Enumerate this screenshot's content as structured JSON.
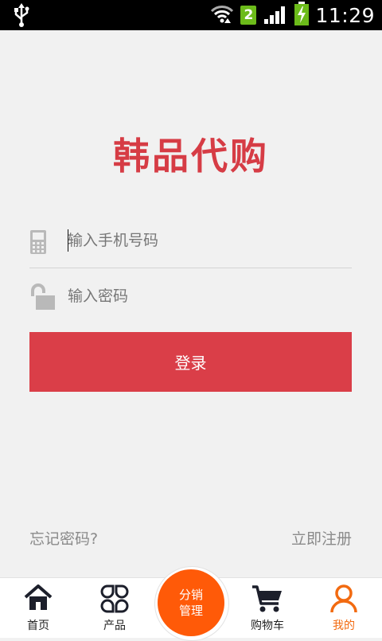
{
  "status_bar": {
    "usb_icon": "usb-icon",
    "wifi_icon": "wifi-icon",
    "sim_slot": "2",
    "signal_icon": "signal-icon",
    "battery_icon": "battery-charging-icon",
    "time": "11:29"
  },
  "brand": {
    "title": "韩品代购",
    "color": "#d63c45"
  },
  "login_form": {
    "phone": {
      "icon": "phone-icon",
      "placeholder": "输入手机号码",
      "value": ""
    },
    "password": {
      "icon": "unlock-icon",
      "placeholder": "输入密码",
      "value": ""
    },
    "login_button": "登录",
    "accent_color": "#da3e48"
  },
  "links": {
    "forgot_password": "忘记密码?",
    "register": "立即注册"
  },
  "tab_bar": {
    "active_color": "#f26a10",
    "center_button": {
      "line1": "分销",
      "line2": "管理",
      "color": "#ff5a08"
    },
    "tabs": [
      {
        "label": "首页",
        "icon": "home-icon",
        "active": false
      },
      {
        "label": "产品",
        "icon": "grid-icon",
        "active": false
      },
      {
        "label": "购物车",
        "icon": "cart-icon",
        "active": false
      },
      {
        "label": "我的",
        "icon": "user-icon",
        "active": true
      }
    ]
  }
}
